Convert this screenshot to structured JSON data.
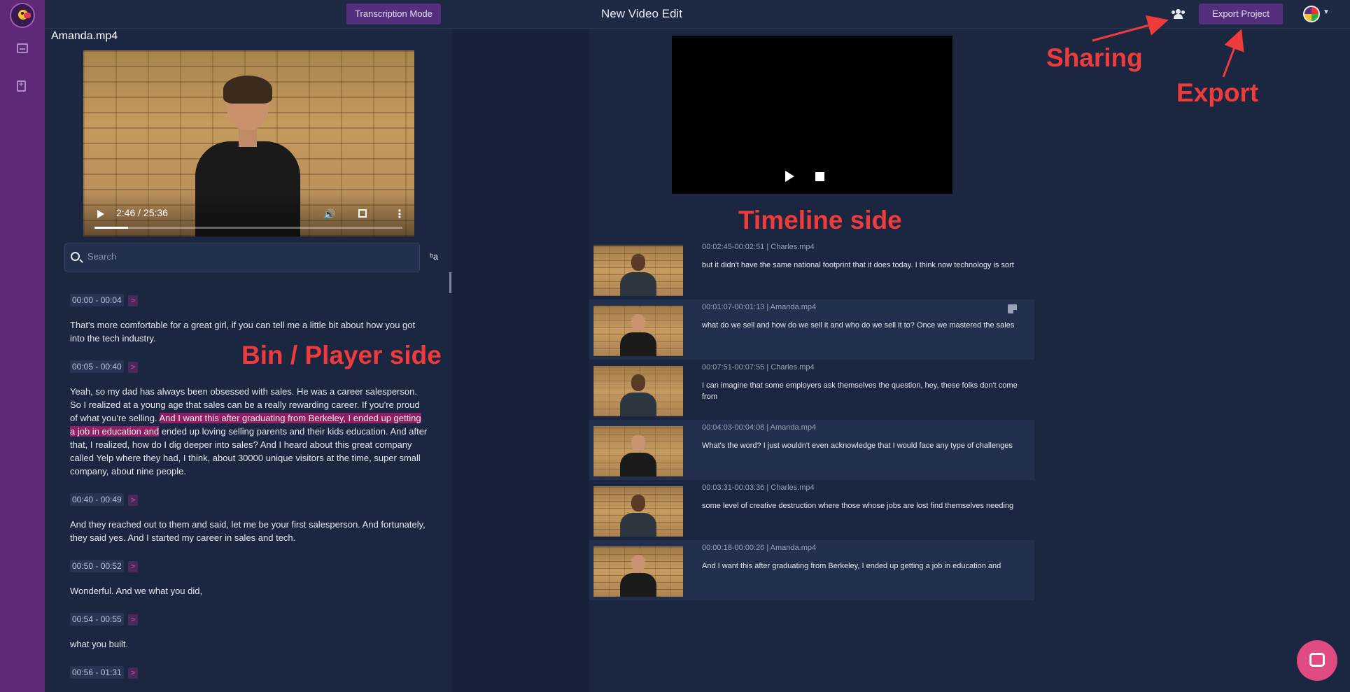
{
  "topbar": {
    "transcription_mode": "Transcription Mode",
    "project_title": "New Video Edit",
    "export_label": "Export Project"
  },
  "icons": {
    "logo": "parrot-logo-icon",
    "rail": [
      "inbox-icon",
      "add-document-icon"
    ],
    "share": "users-icon",
    "chat": "chat-bubble-icon"
  },
  "bin": {
    "file_name": "Amanda.mp4",
    "player": {
      "time": "2:46 / 25:36",
      "progress": 0.108
    },
    "search_placeholder": "Search",
    "case_toggle": "ᵇa",
    "segments": [
      {
        "time": "00:00 - 00:04",
        "go": ">",
        "text_before": "That's more comfortable for a great girl, if you can tell me a little bit about how you got into the tech industry.",
        "highlight": "",
        "text_after": ""
      },
      {
        "time": "00:05 - 00:40",
        "go": ">",
        "text_before": "Yeah, so my dad has always been obsessed with sales. He was a career salesperson. So I realized at a young age that sales can be a really rewarding career. If you're proud of what you're selling. ",
        "highlight": "And I want this after graduating from Berkeley, I ended up getting a job in education and",
        "text_after": " ended up loving selling parents and their kids education. And after that, I realized, how do I dig deeper into sales? And I heard about this great company called Yelp where they had, I think, about 30000 unique visitors at the time, super small company, about nine people."
      },
      {
        "time": "00:40 - 00:49",
        "go": ">",
        "text_before": "And they reached out to them and said, let me be your first salesperson. And fortunately, they said yes. And I started my career in sales and tech.",
        "highlight": "",
        "text_after": ""
      },
      {
        "time": "00:50 - 00:52",
        "go": ">",
        "text_before": "Wonderful. And we what you did,",
        "highlight": "",
        "text_after": ""
      },
      {
        "time": "00:54 - 00:55",
        "go": ">",
        "text_before": "what you built.",
        "highlight": "",
        "text_after": ""
      },
      {
        "time": "00:56 - 01:31",
        "go": ">",
        "text_before": "",
        "highlight": "",
        "text_after": ""
      }
    ]
  },
  "timeline": {
    "clips": [
      {
        "meta": "00:02:45-00:02:51 | Charles.mp4",
        "text": "but it didn't have the same national footprint that it does today. I think now technology is sort",
        "speaker": "charles"
      },
      {
        "meta": "00:01:07-00:01:13 | Amanda.mp4",
        "text": "what do we sell and how do we sell it and who do we sell it to? Once we mastered the sales",
        "speaker": "amanda"
      },
      {
        "meta": "00:07:51-00:07:55 | Charles.mp4",
        "text": "I can imagine that some employers ask themselves the question, hey, these folks don't come from",
        "speaker": "charles"
      },
      {
        "meta": "00:04:03-00:04:08 | Amanda.mp4",
        "text": "What's the word? I just wouldn't even acknowledge that I would face any type of challenges",
        "speaker": "amanda"
      },
      {
        "meta": "00:03:31-00:03:36 | Charles.mp4",
        "text": "some level of creative destruction where those whose jobs are lost find themselves needing",
        "speaker": "charles"
      },
      {
        "meta": "00:00:18-00:00:26 | Amanda.mp4",
        "text": "And I want this after graduating from Berkeley, I ended up getting a job in education and",
        "speaker": "amanda"
      }
    ]
  },
  "annotations": {
    "bin": "Bin / Player side",
    "timeline": "Timeline side",
    "sharing": "Sharing",
    "export": "Export",
    "color": "#ef3b3b"
  }
}
